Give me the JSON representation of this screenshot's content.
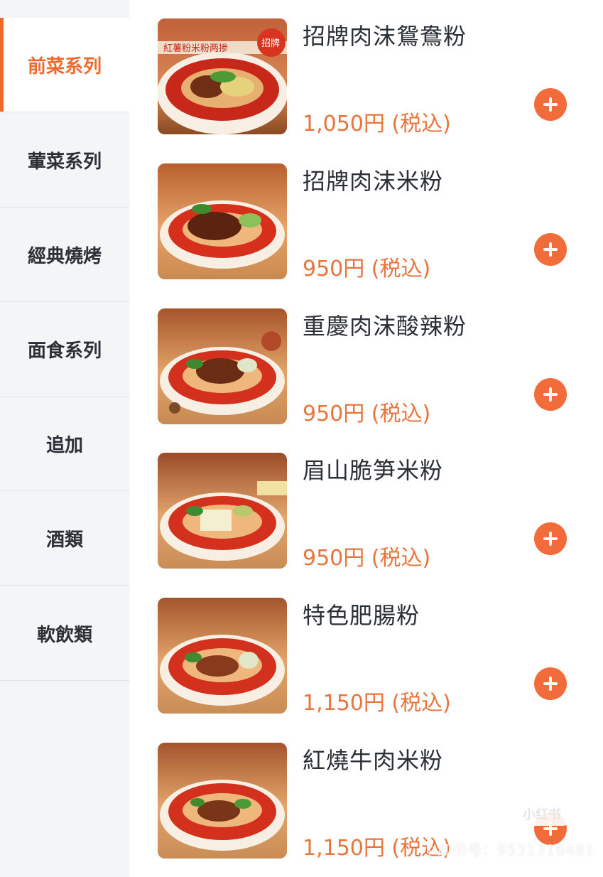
{
  "sidebar": {
    "items": [
      {
        "label": "前菜系列",
        "active": true
      },
      {
        "label": "葷菜系列",
        "active": false
      },
      {
        "label": "經典燒烤",
        "active": false
      },
      {
        "label": "面食系列",
        "active": false
      },
      {
        "label": "追加",
        "active": false
      },
      {
        "label": "酒類",
        "active": false
      },
      {
        "label": "軟飲類",
        "active": false
      }
    ]
  },
  "menu": {
    "items": [
      {
        "name": "招牌肉沫鴛鴦粉",
        "price": "1,050円 (税込)",
        "bowl_text": "紅薯粉米粉两掺",
        "badge": "招牌"
      },
      {
        "name": "招牌肉沫米粉",
        "price": "950円 (税込)"
      },
      {
        "name": "重慶肉沫酸辣粉",
        "price": "950円 (税込)"
      },
      {
        "name": "眉山脆笋米粉",
        "price": "950円 (税込)"
      },
      {
        "name": "特色肥腸粉",
        "price": "1,150円 (税込)"
      },
      {
        "name": "紅燒牛肉米粉",
        "price": "1,150円 (税込)"
      }
    ]
  },
  "watermark": {
    "text": "小红书号：9531316481",
    "logo": "小红书"
  },
  "colors": {
    "accent": "#ef6a2c",
    "price": "#e8743c",
    "add_button": "#f26b3a",
    "sidebar_bg": "#f4f5f7"
  },
  "icons": {
    "add": "plus-circle-icon"
  }
}
